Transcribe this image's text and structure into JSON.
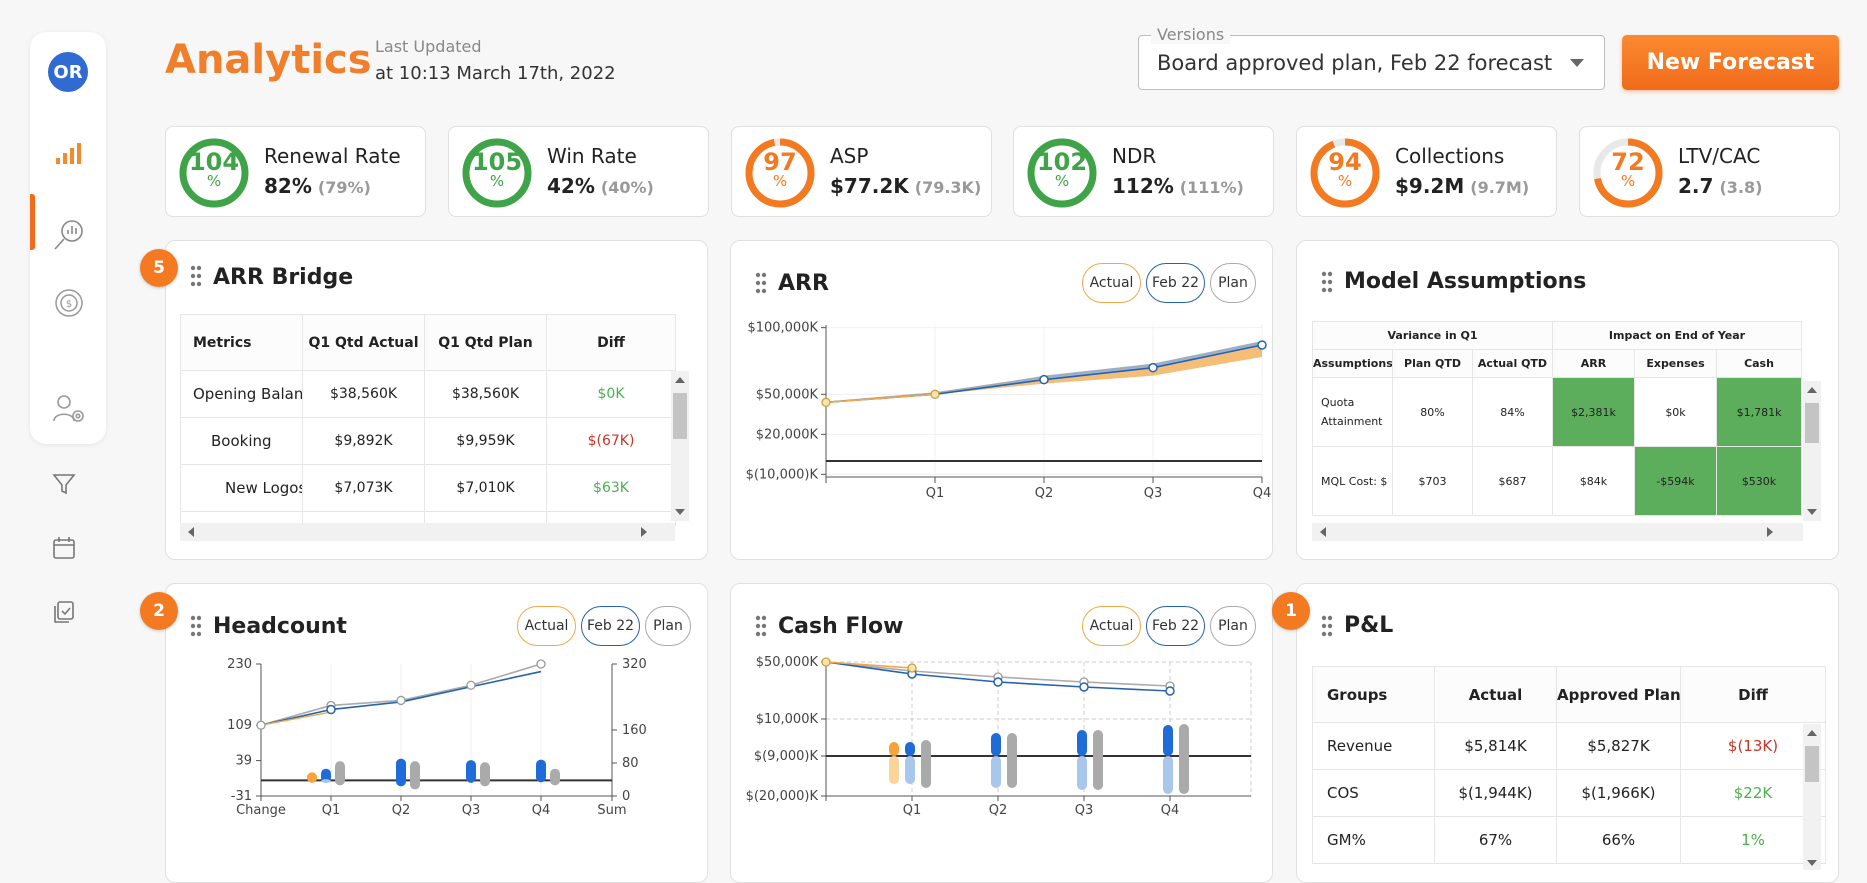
{
  "colors": {
    "accent": "#f07f2c",
    "green": "#3fa447",
    "orange": "#f47a22",
    "navy": "#2463ad",
    "actual": "#f0a84b",
    "feb": "#1f6bd8",
    "plan": "#aaaaaa",
    "pos": "#4caf50",
    "neg": "#c0392b",
    "heat_green": "#5cae5c"
  },
  "sidebar": {
    "avatar": "OR",
    "items": [
      {
        "icon": "bar-chart-icon"
      },
      {
        "icon": "analytics-search-icon",
        "active": true
      },
      {
        "icon": "dollar-coin-icon"
      },
      {
        "icon": "user-settings-icon"
      }
    ],
    "extra_icons": [
      "filter-icon",
      "calendar-icon",
      "documents-icon"
    ]
  },
  "header": {
    "title": "Analytics",
    "last_updated_label": "Last Updated",
    "last_updated_value": "at 10:13 March 17th, 2022",
    "versions_label": "Versions",
    "versions_value": "Board approved plan, Feb 22 forecast",
    "new_forecast_label": "New Forecast"
  },
  "kpis": [
    {
      "score": "104",
      "pct": "%",
      "label": "Renewal Rate",
      "value": "82%",
      "sub": "(79%)",
      "color": "green",
      "fill": 1.0
    },
    {
      "score": "105",
      "pct": "%",
      "label": "Win Rate",
      "value": "42%",
      "sub": "(40%)",
      "color": "green",
      "fill": 1.0
    },
    {
      "score": "97",
      "pct": "%",
      "label": "ASP",
      "value": "$77.2K",
      "sub": "(79.3K)",
      "color": "orange",
      "fill": 0.97
    },
    {
      "score": "102",
      "pct": "%",
      "label": "NDR",
      "value": "112%",
      "sub": "(111%)",
      "color": "green",
      "fill": 1.0
    },
    {
      "score": "94",
      "pct": "%",
      "label": "Collections",
      "value": "$9.2M",
      "sub": "(9.7M)",
      "color": "orange",
      "fill": 0.94
    },
    {
      "score": "72",
      "pct": "%",
      "label": "LTV/CAC",
      "value": "2.7",
      "sub": "(3.8)",
      "color": "orange",
      "fill": 0.72
    }
  ],
  "arr_bridge": {
    "badge": "5",
    "title": "ARR Bridge",
    "columns": [
      "Metrics",
      "Q1 Qtd Actual",
      "Q1 Qtd Plan",
      "Diff"
    ],
    "rows": [
      {
        "metric": "Opening Balanc",
        "actual": "$38,560K",
        "plan": "$38,560K",
        "diff": "$0K",
        "sign": "pos"
      },
      {
        "metric": "Booking",
        "actual": "$9,892K",
        "plan": "$9,959K",
        "diff": "$(67K)",
        "sign": "neg"
      },
      {
        "metric": "New Logos",
        "actual": "$7,073K",
        "plan": "$7,010K",
        "diff": "$63K",
        "sign": "pos"
      }
    ]
  },
  "legend": {
    "actual": "Actual",
    "feb": "Feb 22",
    "plan": "Plan"
  },
  "model_assumptions": {
    "title": "Model Assumptions",
    "group1": "Variance in Q1",
    "group2": "Impact on End of Year",
    "columns": [
      "Assumptions",
      "Plan QTD",
      "Actual QTD",
      "ARR",
      "Expenses",
      "Cash"
    ],
    "rows": [
      {
        "name": "Quota Attainment",
        "plan": "80%",
        "actual": "84%",
        "arr": "$2,381k",
        "expenses": "$0k",
        "cash": "$1,781k",
        "hl": [
          true,
          false,
          true
        ]
      },
      {
        "name": "MQL Cost: $",
        "plan": "$703",
        "actual": "$687",
        "arr": "$84k",
        "expenses": "-$594k",
        "cash": "$530k",
        "hl": [
          false,
          true,
          true
        ]
      }
    ]
  },
  "pnl": {
    "badge": "1",
    "title": "P&L",
    "columns": [
      "Groups",
      "Actual",
      "Approved Plan",
      "Diff"
    ],
    "rows": [
      {
        "group": "Revenue",
        "actual": "$5,814K",
        "plan": "$5,827K",
        "diff": "$(13K)",
        "sign": "neg"
      },
      {
        "group": "COS",
        "actual": "$(1,944K)",
        "plan": "$(1,966K)",
        "diff": "$22K",
        "sign": "pos"
      },
      {
        "group": "GM%",
        "actual": "67%",
        "plan": "66%",
        "diff": "1%",
        "sign": "pos"
      }
    ]
  },
  "chart_data": [
    {
      "type": "line",
      "title": "ARR",
      "x": [
        "",
        "Q1",
        "Q2",
        "Q3",
        "Q4"
      ],
      "yticks": [
        "$100,000K",
        "$50,000K",
        "$20,000K",
        "$(10,000)K"
      ],
      "series": [
        {
          "name": "Actual",
          "values": [
            44000,
            50000,
            null,
            null,
            null
          ]
        },
        {
          "name": "Feb 22",
          "values": [
            44000,
            50000,
            61000,
            70000,
            87000
          ]
        },
        {
          "name": "Plan",
          "values": [
            44000,
            51000,
            63000,
            72000,
            89000
          ]
        }
      ]
    },
    {
      "type": "bar",
      "title": "Headcount",
      "badge": "2",
      "categories": [
        "Change",
        "Q1",
        "Q2",
        "Q3",
        "Q4",
        "Sum"
      ],
      "left_ticks": [
        "230",
        "109",
        "39",
        "-31"
      ],
      "right_ticks": [
        "320",
        "160",
        "80",
        "0"
      ],
      "series": [
        {
          "name": "Feb 22",
          "line": [
            109,
            140,
            155,
            185,
            215
          ]
        },
        {
          "name": "Plan",
          "line": [
            109,
            148,
            158,
            188,
            230
          ]
        }
      ]
    },
    {
      "type": "bar",
      "title": "Cash Flow",
      "categories": [
        "",
        "Q1",
        "Q2",
        "Q3",
        "Q4"
      ],
      "yticks": [
        "$50,000K",
        "$10,000K",
        "$(9,000)K",
        "$(20,000)K"
      ],
      "series": [
        {
          "name": "Actual",
          "line": [
            50000,
            41000,
            null,
            null,
            null
          ]
        },
        {
          "name": "Feb 22",
          "line": [
            50000,
            38000,
            31000,
            26000,
            22000
          ]
        },
        {
          "name": "Plan",
          "line": [
            50000,
            42000,
            36000,
            31000,
            28000
          ]
        }
      ]
    }
  ]
}
